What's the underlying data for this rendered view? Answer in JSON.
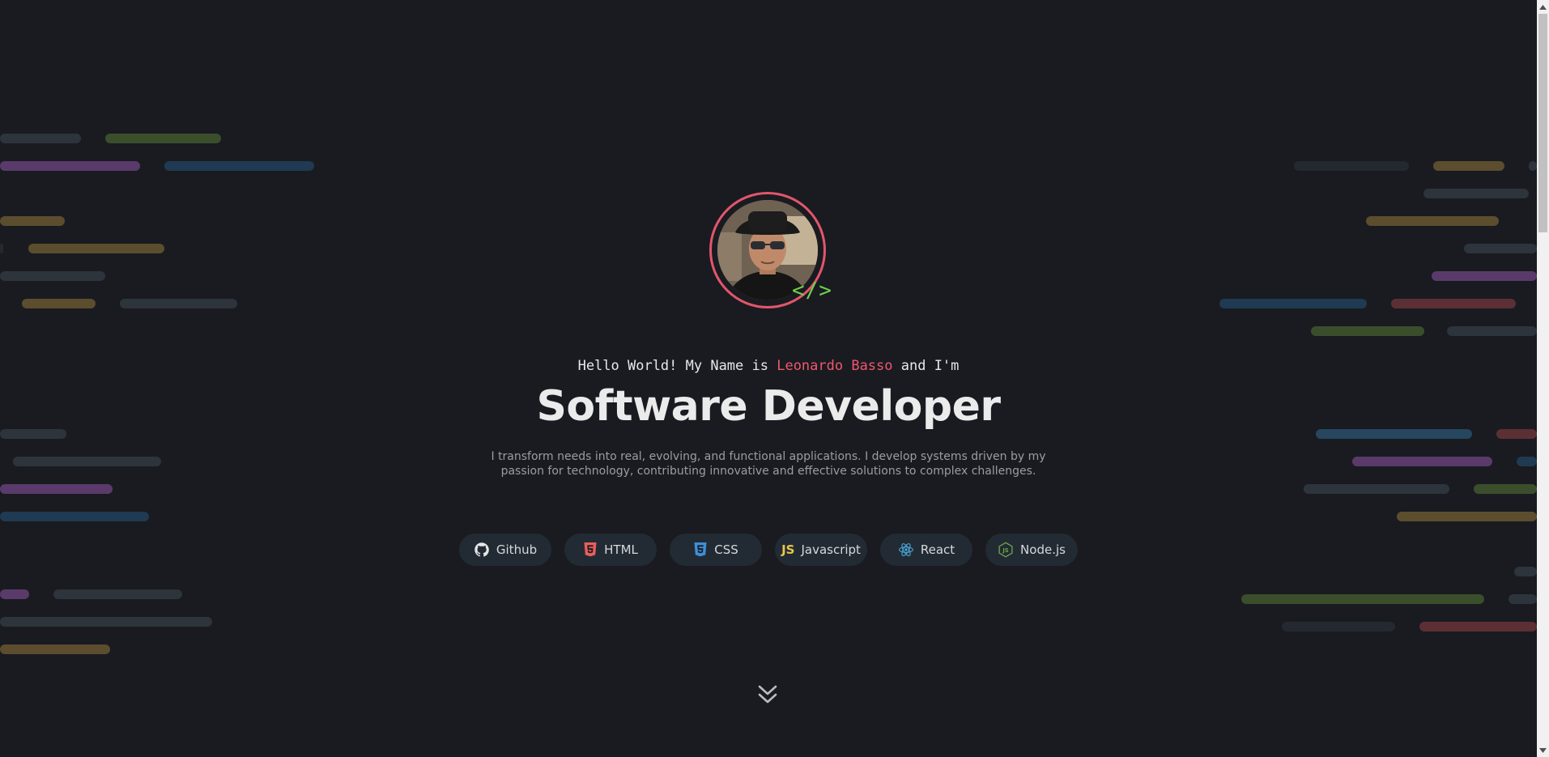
{
  "hero": {
    "greeting_prefix": "Hello World! My Name is ",
    "name": "Leonardo Basso",
    "greeting_suffix": " and I'm",
    "title": "Software Developer",
    "description": "I transform needs into real, evolving, and functional applications. I develop systems driven by my passion for technology, contributing innovative and effective solutions to complex challenges.",
    "code_badge": "</>"
  },
  "skills": [
    {
      "label": "Github",
      "icon": "github-icon",
      "color": "#e6e6e6"
    },
    {
      "label": "HTML",
      "icon": "html5-icon",
      "color": "#e95f5f"
    },
    {
      "label": "CSS",
      "icon": "css3-icon",
      "color": "#3e8fd8"
    },
    {
      "label": "Javascript",
      "icon": "javascript-icon",
      "color": "#e9c64a",
      "mark": "JS"
    },
    {
      "label": "React",
      "icon": "react-icon",
      "color": "#4aa6d8"
    },
    {
      "label": "Node.js",
      "icon": "nodejs-icon",
      "color": "#6fa34a"
    }
  ],
  "colors": {
    "background": "#191b20",
    "accent": "#f0576c",
    "chip_background": "#222b33",
    "code_green": "#6fcf4a"
  },
  "scroll_indicator": "chevrons-down-icon"
}
